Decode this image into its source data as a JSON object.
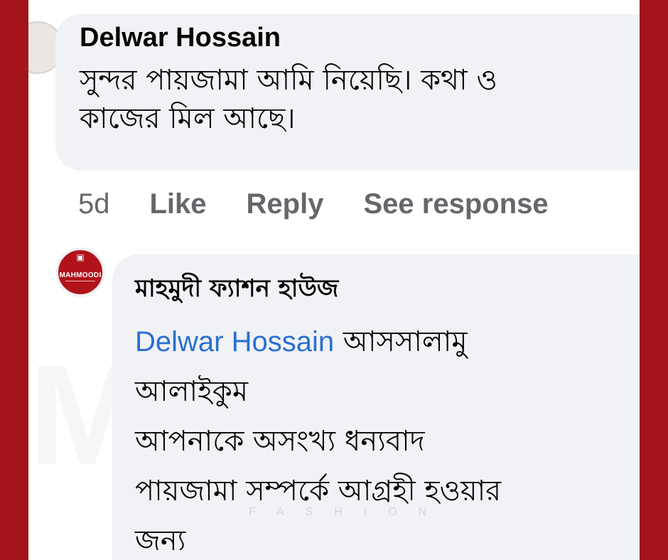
{
  "colors": {
    "frame": "#a3141b",
    "bubble": "#f0f2f5",
    "text": "#050505",
    "meta": "#65676b",
    "mention": "#2a6fd1"
  },
  "watermark": {
    "text": "MAHMOODI",
    "subtext": "FASHION"
  },
  "comment": {
    "author": "Delwar Hossain",
    "lines": [
      "সুন্দর পায়জামা  আমি  নিয়েছি। কথা ও",
      "কাজের  মিল আছে।"
    ],
    "time": "5d",
    "actions": {
      "like": "Like",
      "reply": "Reply",
      "see_response": "See response"
    }
  },
  "reply": {
    "avatar_logo": "MAHMOODI",
    "avatar_icon": "brand-logo-icon",
    "author": "মাহমুদী ফ্যাশন হাউজ",
    "mention": "Delwar Hossain",
    "line1_rest": " আসসালামু",
    "lines": [
      "আলাইকুম",
      "আপনাকে অসংখ্য ধন্যবাদ",
      "পায়জামা সম্পর্কে আগ্রহী হওয়ার",
      "জন্য"
    ]
  }
}
